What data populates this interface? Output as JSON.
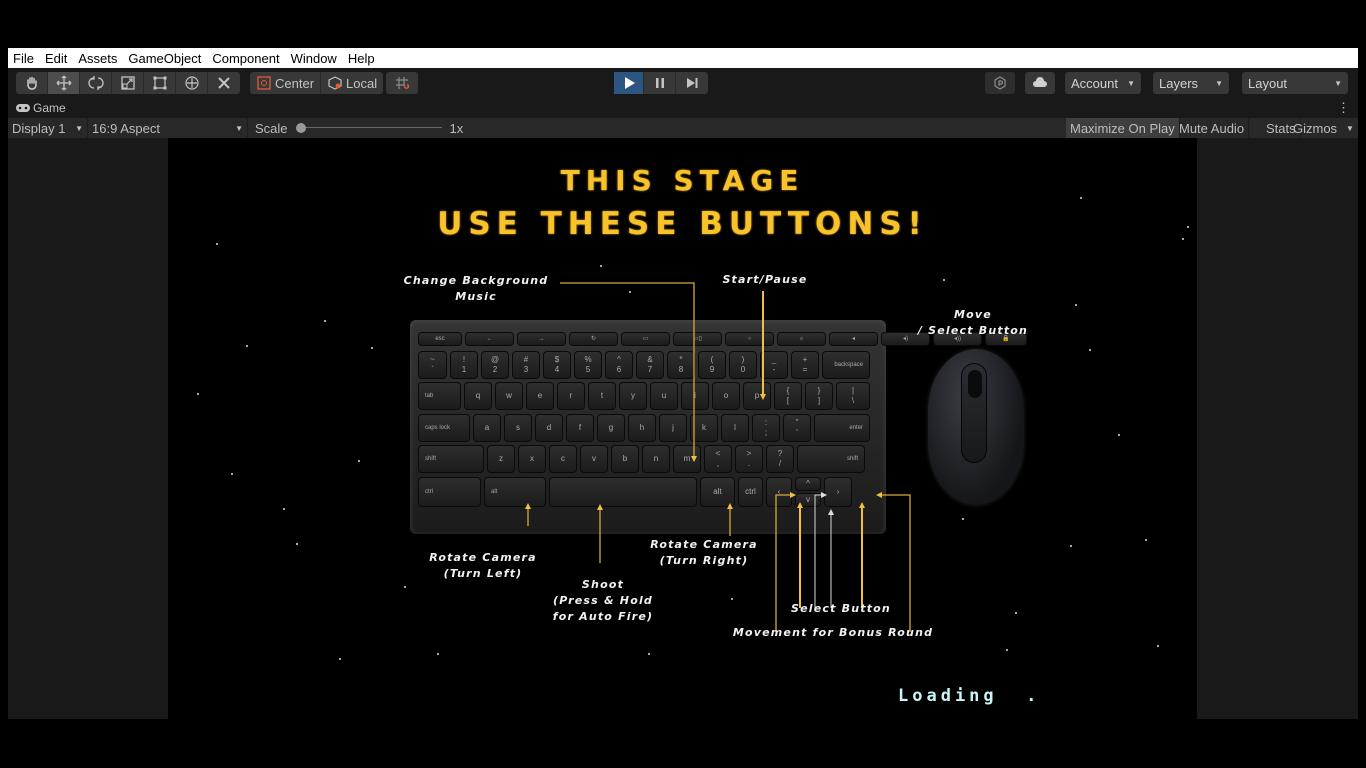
{
  "menu": [
    "File",
    "Edit",
    "Assets",
    "GameObject",
    "Component",
    "Window",
    "Help"
  ],
  "toolbar": {
    "tools": [
      {
        "name": "hand-tool",
        "icon": "hand-icon"
      },
      {
        "name": "move-tool",
        "icon": "move-icon",
        "active": true
      },
      {
        "name": "rotate-tool",
        "icon": "rotate-icon"
      },
      {
        "name": "scale-tool",
        "icon": "scale-icon"
      },
      {
        "name": "rect-tool",
        "icon": "rect-icon"
      },
      {
        "name": "transform-tool",
        "icon": "transform-icon"
      },
      {
        "name": "custom-tool",
        "icon": "custom-tools-icon"
      }
    ],
    "pivot_label": "Center",
    "space_label": "Local",
    "account_label": "Account",
    "layers_label": "Layers",
    "layout_label": "Layout",
    "play_state": "playing",
    "accent_color": "#2d5581"
  },
  "game_tab": {
    "title": "Game",
    "display": "Display 1",
    "aspect": "16:9 Aspect",
    "scale_label": "Scale",
    "scale_value": "1x",
    "scale_fraction": 0.0,
    "maximize_label": "Maximize On Play",
    "mute_label": "Mute Audio",
    "stats_label": "Stats",
    "gizmos_label": "Gizmos"
  },
  "game": {
    "title_line1": "THIS STAGE",
    "title_line2": "USE THESE BUTTONS!",
    "title_color": "#f7c22a",
    "labels": {
      "change_music": "Change Background\nMusic",
      "start_pause": "Start/Pause",
      "move_select": "Move\n/ Select Button",
      "rotate_left": "Rotate Camera\n(Turn Left)",
      "shoot": "Shoot\n(Press & Hold\nfor Auto Fire)",
      "rotate_right": "Rotate Camera\n(Turn Right)",
      "select_button": "Select Button",
      "bonus_movement": "Movement for Bonus Round"
    },
    "loading_text": "Loading  .",
    "keyboard": {
      "row0": [
        "esc",
        "←",
        "→",
        "↻",
        "▭",
        "▭▯",
        "○",
        "☼",
        "◂",
        "◂)",
        "◂))",
        "🔒"
      ],
      "row1": [
        "~\n`",
        "!\n1",
        "@\n2",
        "#\n3",
        "$\n4",
        "%\n5",
        "^\n6",
        "&\n7",
        "*\n8",
        "(\n9",
        ")\n0",
        "_\n-",
        "+\n=",
        "backspace"
      ],
      "row2": [
        "tab",
        "q",
        "w",
        "e",
        "r",
        "t",
        "y",
        "u",
        "i",
        "o",
        "p",
        "{\n[",
        "}\n]",
        "|\n\\"
      ],
      "row3": [
        "caps lock",
        "a",
        "s",
        "d",
        "f",
        "g",
        "h",
        "j",
        "k",
        "l",
        ":\n;",
        "\"\n'",
        "enter"
      ],
      "row4": [
        "shift",
        "z",
        "x",
        "c",
        "v",
        "b",
        "n",
        "m",
        "<\n,",
        ">\n.",
        "?\n/",
        "shift"
      ],
      "row5": [
        "ctrl",
        "alt",
        "",
        "alt",
        "ctrl",
        "‹",
        "^",
        "v",
        "›"
      ]
    }
  }
}
